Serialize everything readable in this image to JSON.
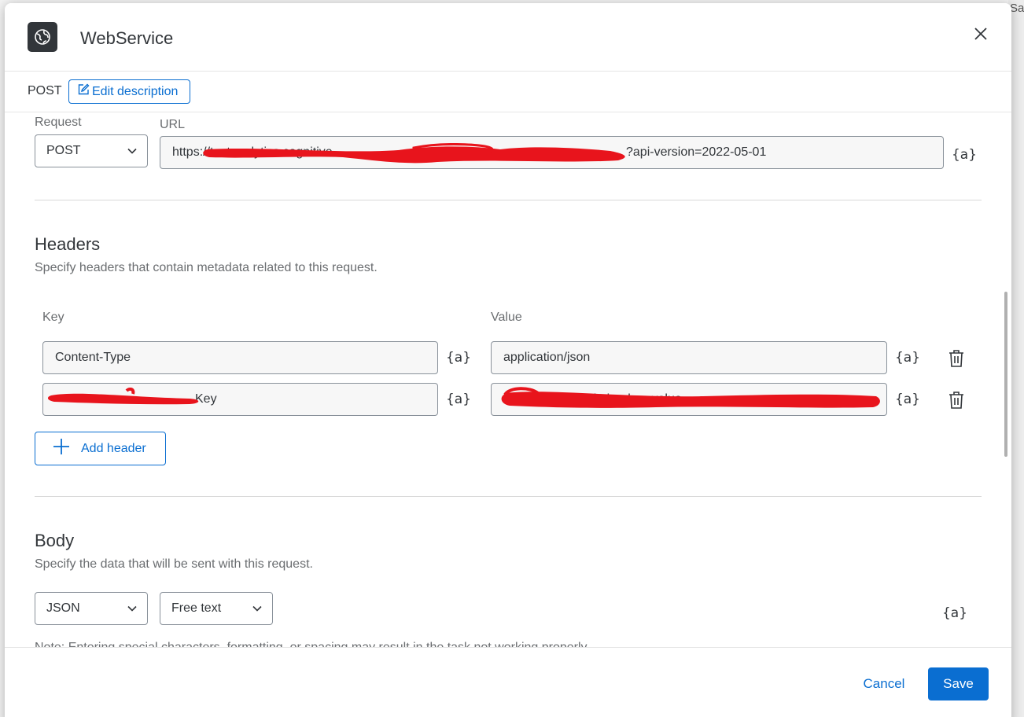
{
  "background": {
    "corner_text": "Sa"
  },
  "dialog": {
    "title": "WebService",
    "app_icon": "globe-icon",
    "close_icon": "close-icon"
  },
  "subbar": {
    "method": "POST",
    "edit_description": "Edit description",
    "edit_icon": "edit-icon"
  },
  "request": {
    "request_label": "Request",
    "method_value": "POST",
    "url_label": "URL",
    "url_value": "https://textanalytics.cognitiveservices.azure.com/language/analyze-jobs?api-version=2022-05-01",
    "url_visible_suffix": "?api-version=2022-05-01",
    "variable_icon": "{a}"
  },
  "headers": {
    "title": "Headers",
    "description": "Specify headers that contain metadata related to this request.",
    "key_label": "Key",
    "value_label": "Value",
    "rows": [
      {
        "key": "Content-Type",
        "value": "application/json"
      },
      {
        "key": "Ocp-Apim-Subscription-Key",
        "value": "redacted-subscription-key-value"
      }
    ],
    "add_label": "Add header"
  },
  "body": {
    "title": "Body",
    "description": "Specify the data that will be sent with this request.",
    "format_value": "JSON",
    "mode_value": "Free text",
    "note": "Note: Entering special characters, formatting, or spacing may result in the task not working properly."
  },
  "footer": {
    "cancel_label": "Cancel",
    "save_label": "Save"
  },
  "colors": {
    "accent": "#0a6ed1",
    "text": "#32363a",
    "muted": "#6a6d70",
    "redaction": "#e8141c"
  }
}
